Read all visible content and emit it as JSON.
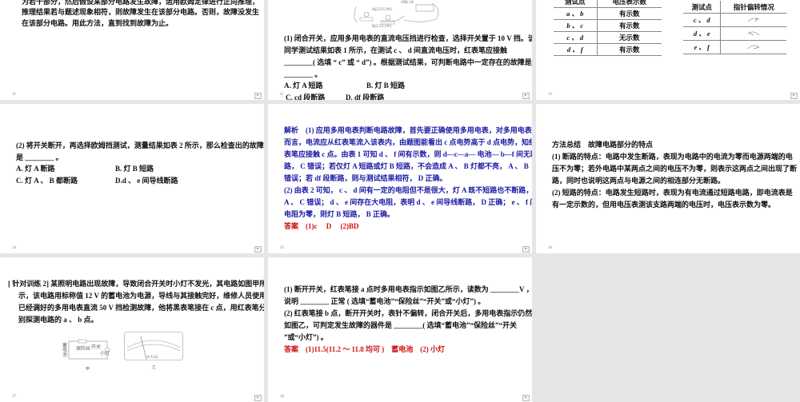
{
  "slides": [
    {
      "num": "11",
      "lines": [
        "为若干部分，然后假设某部分电路发生故障，运用欧姆定律进行正向推理，",
        "推理结果若与题述现象相符，则故障发生在该部分电路。否则，故障没发生",
        "在该部分电路。用此方法，直到找到故障为止。"
      ]
    },
    {
      "num": "12",
      "figure": {
        "lamp_a": "A(2.5V,1W)",
        "lamp_b": "B(2.5V,1W)",
        "rheostat": "10Ω 1A"
      },
      "lines": [
        "(1) 闭合开关，应用多用电表的直流电压挡进行检查，选择开关置于 10 V 挡。该",
        "同学测试结果如表 1 所示，在测试 c 、 d 间直流电压时，红表笔应接触",
        "________( 选填 “ c” 或 “ d”) 。根据测试结果，可判断电路中一定存在的故障是",
        "________ 。"
      ],
      "options": [
        "A. 灯 A 短路",
        "B. 灯 B 短路",
        "C. cd 段断路",
        "D. df 段断路"
      ]
    },
    {
      "num": "13",
      "table1": {
        "headers": [
          "测试点",
          "电压表示数"
        ],
        "rows": [
          [
            "a 、 b",
            "有示数"
          ],
          [
            "b 、 c",
            "有示数"
          ],
          [
            "c 、 d",
            "无示数"
          ],
          [
            "d 、 f",
            "有示数"
          ]
        ]
      },
      "table2": {
        "headers": [
          "测试点",
          "指针偏转情况"
        ],
        "rows": [
          [
            "c 、 d",
            "pointer-right"
          ],
          [
            "d 、 e",
            "pointer-left"
          ],
          [
            "e 、 f",
            "pointer-right-far"
          ]
        ]
      }
    },
    {
      "num": "14",
      "lines": [
        "(2) 将开关断开，再选择欧姆挡测试，测量结果如表 2 所示，那么检查出的故障",
        "是 ________ 。"
      ],
      "options": [
        "A. 灯 A 断路",
        "B. 灯 B 短路",
        "C. 灯 A 、 B 都断路",
        "D.d 、 e 间导线断路"
      ]
    },
    {
      "num": "15",
      "lines": [
        "解析　(1) 应用多用电表判断电路故障，首先要正确使用多用电表，对多用电表",
        "而言，电流应从红表笔流入该表内，由题图能看出 c 点电势高于 d 点电势，知红",
        "表笔应接触 c 点。由表 1 可知 d 、 f 间有示数，则 d—c—a— 电池— b—f 间无断",
        "路， C 错误；若仅灯 A 短路或灯 B 短路，不会造成 A 、 B 灯都不亮， A 、 B",
        "错误；若 df 段断路，则与测试结果相符， D 正确。",
        "(2) 由表 2 可知， c 、 d 间有一定的电阻但不是很大，灯 A 既不短路也不断路，",
        "A 、 C 错误； d 、 e 间存在大电阻，表明 d 、 e 间导线断路， D 正确； e 、 f 间",
        "电阻为零，则灯 B 短路， B 正确。"
      ],
      "answer": "答案　(1)c　 D　 (2)BD"
    },
    {
      "num": "16",
      "title": "方法总结　故障电路部分的特点",
      "lines": [
        "(1) 断路的特点：电路中发生断路，表现为电路中的电流为零而电源两端的电",
        "压不为零；若外电路中某两点之间的电压不为零，则表示这两点之间出现了断",
        "路，同时也说明这两点与电源之间的相连部分无断路。",
        "(2) 短路的特点：电路发生短路时，表现为有电流通过短路电路，即电流表是",
        "有一定示数的，但用电压表测该支路两端的电压时，电压表示数为零。"
      ]
    },
    {
      "num": "17",
      "lines": [
        "[ 针对训练 2]  某照明电路出现故障，导致闭合开关时小灯不发光，其电路如图甲所",
        "示，该电路用标称值 12 V 的蓄电池为电源，导线与其接触完好，维修人员使用",
        "已经调好的多用电表直流 50 V 挡检测故障，他将黑表笔接在 c 点，用红表笔分",
        "别探测电路的 a 、 b 点。"
      ],
      "figure": {
        "battery": "蓄电池",
        "fuse": "保险丝",
        "switch": "开关",
        "lamp": "小灯",
        "caption_a": "甲",
        "caption_b": "乙",
        "meter_label": "A-V-Ω"
      }
    },
    {
      "num": "18",
      "lines": [
        "(1) 断开开关，红表笔接 a 点时多用电表指示如图乙所示，读数为 ________V ，",
        "说明 ________ 正常 ( 选填“蓄电池”“保险丝”“开关”或“小灯”) 。",
        "(2) 红表笔接 b 点，断开开关时，表针不偏转，闭合开关后，多用电表指示仍然",
        "如图乙，可判定发生故障的器件是 ________( 选填“蓄电池”“保险丝”“开关",
        "”或“小灯”) 。"
      ],
      "answer": "答案　(1)11.5(11.2 ～ 11.8 均可 )　蓄电池　(2) 小灯"
    }
  ],
  "nav_icon": "next-slide-icon"
}
